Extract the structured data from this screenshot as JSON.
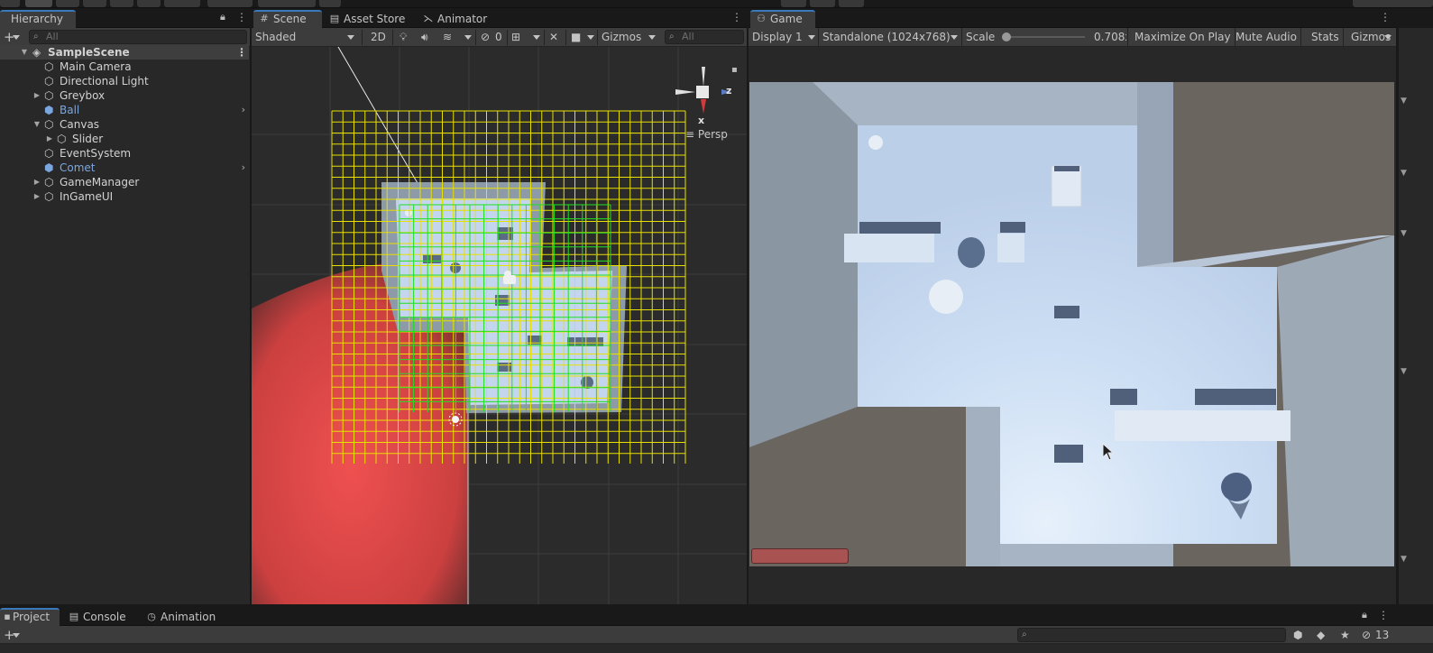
{
  "hierarchy": {
    "tab_label": "Hierarchy",
    "search_placeholder": "All",
    "scene_name": "SampleScene",
    "items": [
      {
        "label": "Main Camera"
      },
      {
        "label": "Directional Light"
      },
      {
        "label": "Greybox"
      },
      {
        "label": "Ball"
      },
      {
        "label": "Canvas"
      },
      {
        "label": "Slider"
      },
      {
        "label": "EventSystem"
      },
      {
        "label": "Comet"
      },
      {
        "label": "GameManager"
      },
      {
        "label": "InGameUI"
      }
    ]
  },
  "scene_view": {
    "tabs": [
      {
        "label": "Scene"
      },
      {
        "label": "Asset Store"
      },
      {
        "label": "Animator"
      }
    ],
    "shading_mode": "Shaded",
    "mode_2d": "2D",
    "hidden_count": "0",
    "gizmos_label": "Gizmos",
    "search_placeholder": "All",
    "projection_label": "Persp",
    "axis_x": "x",
    "axis_z": "z"
  },
  "game_view": {
    "tab_label": "Game",
    "display": "Display 1",
    "resolution": "Standalone (1024x768)",
    "scale_label": "Scale",
    "scale_value": "0.708x",
    "maximize_label": "Maximize On Play",
    "mute_label": "Mute Audio",
    "stats_label": "Stats",
    "gizmos_label": "Gizmos"
  },
  "bottom_panel": {
    "tabs": [
      {
        "label": "Project"
      },
      {
        "label": "Console"
      },
      {
        "label": "Animation"
      }
    ],
    "hidden_count": "13"
  },
  "colors": {
    "selection_blue": "#7ba6e0",
    "grid_yellow": "#e8e000",
    "grid_green": "#20e020",
    "floor_blue": "#c4d8f0",
    "red_object": "#e04848"
  }
}
